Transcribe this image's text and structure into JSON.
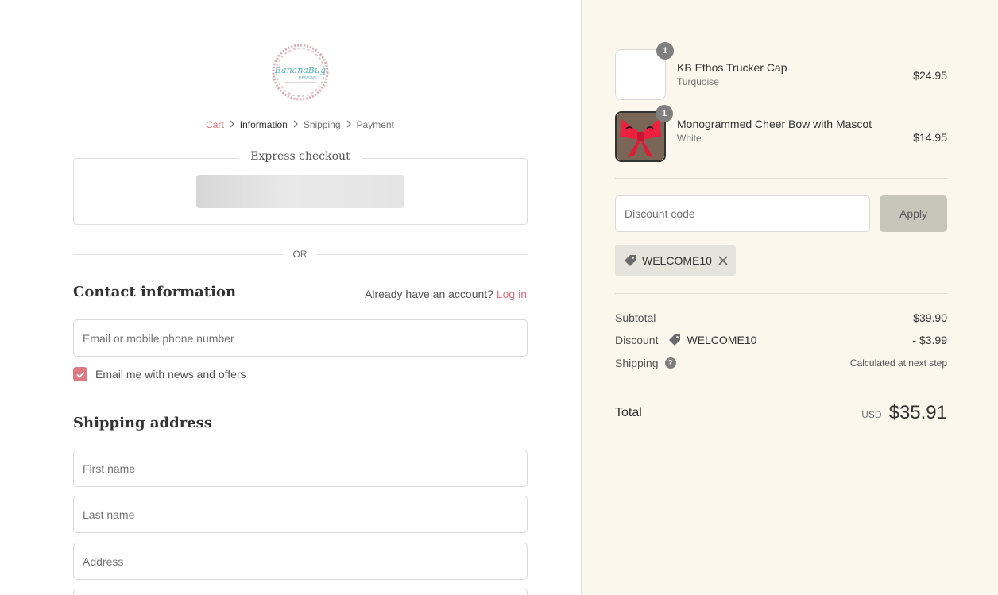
{
  "breadcrumb": {
    "cart": "Cart",
    "information": "Information",
    "shipping": "Shipping",
    "payment": "Payment"
  },
  "logo": {
    "brand_text": "BananaBug",
    "brand_sub": "DESIGNS"
  },
  "express": {
    "title": "Express checkout"
  },
  "or_label": "OR",
  "contact": {
    "title": "Contact information",
    "account_prompt": "Already have an account?",
    "login_label": "Log in",
    "email_placeholder": "Email or mobile phone number",
    "newsletter_label": "Email me with news and offers",
    "newsletter_checked": true
  },
  "shipping_address": {
    "title": "Shipping address",
    "first_name_placeholder": "First name",
    "last_name_placeholder": "Last name",
    "address_placeholder": "Address"
  },
  "cart_items": [
    {
      "name": "KB Ethos Trucker Cap",
      "variant": "Turquoise",
      "price": "$24.95",
      "quantity": "1"
    },
    {
      "name": "Monogrammed Cheer Bow with Mascot",
      "variant": "White",
      "price": "$14.95",
      "quantity": "1"
    }
  ],
  "discount": {
    "placeholder": "Discount code",
    "apply_label": "Apply",
    "applied_code": "WELCOME10"
  },
  "summary": {
    "subtotal_label": "Subtotal",
    "subtotal_value": "$39.90",
    "discount_label": "Discount",
    "discount_code": "WELCOME10",
    "discount_value": "- $3.99",
    "shipping_label": "Shipping",
    "shipping_value": "Calculated at next step",
    "total_label": "Total",
    "currency": "USD",
    "total_value": "$35.91"
  },
  "colors": {
    "accent": "#d9727c",
    "sidebar_bg": "#fbf7ec",
    "checkbox": "#e07a82",
    "apply_button": "#c8c6ba"
  }
}
